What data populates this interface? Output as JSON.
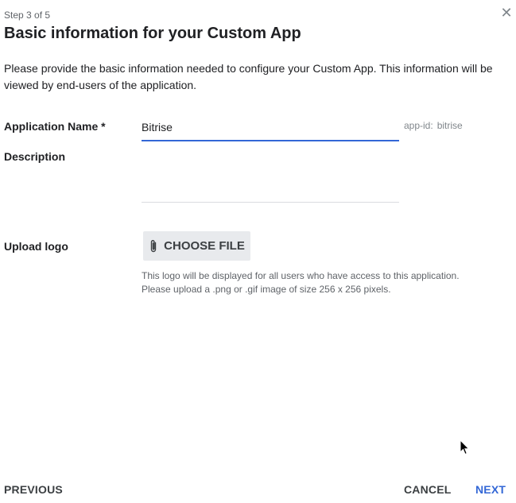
{
  "header": {
    "step": "Step 3 of 5",
    "title": "Basic information for your Custom App",
    "close_icon": "✕"
  },
  "intro": {
    "text": "Please provide the basic information needed to configure your Custom App. This information will be viewed by end-users of the application."
  },
  "form": {
    "app_name_label": "Application Name *",
    "app_name_value": "Bitrise",
    "app_id_label": "app-id:",
    "app_id_value": "bitrise",
    "description_label": "Description",
    "description_value": "",
    "upload_logo_label": "Upload logo",
    "choose_file_label": "CHOOSE FILE",
    "choose_file_icon": "paperclip-icon",
    "logo_help_line1": "This logo will be displayed for all users who have access to this application.",
    "logo_help_line2": "Please upload a .png or .gif image of size 256 x 256 pixels."
  },
  "footer": {
    "previous_label": "PREVIOUS",
    "cancel_label": "CANCEL",
    "next_label": "NEXT"
  },
  "colors": {
    "accent": "#3367d6",
    "text": "#202124",
    "muted": "#5f6368",
    "button_bg": "#e8eaed"
  }
}
